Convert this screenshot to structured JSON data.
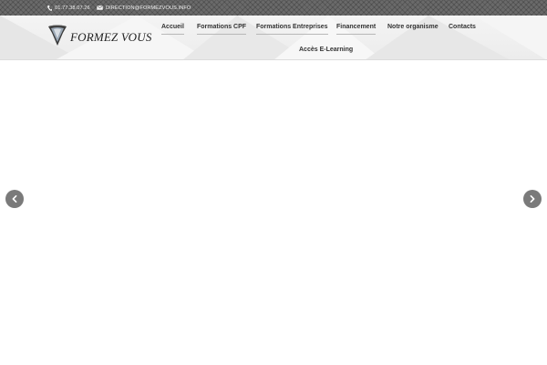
{
  "topbar": {
    "phone": "01.77.38.07.26",
    "email": "DIRECTION@FORMEZVOUS.INFO",
    "phone_icon": "phone-icon",
    "email_icon": "envelope-icon"
  },
  "logo": {
    "text": "FORMEZ VOUS",
    "icon": "shield-v-icon"
  },
  "nav": {
    "items": [
      {
        "label": "Accueil"
      },
      {
        "label": "Formations CPF"
      },
      {
        "label": "Formations Entreprises"
      },
      {
        "label": "Financement"
      },
      {
        "label": "Notre organisme"
      },
      {
        "label": "Contacts"
      },
      {
        "label": "Accès E-Learning"
      }
    ]
  },
  "slider": {
    "prev_icon": "chevron-left-icon",
    "next_icon": "chevron-right-icon"
  },
  "colors": {
    "topbar": "#6a6a6a",
    "header_bg": "#efefef",
    "nav_text": "#333333",
    "nav_underline": "#b8b8b8",
    "arrow_bg": "#7a7a7a"
  }
}
